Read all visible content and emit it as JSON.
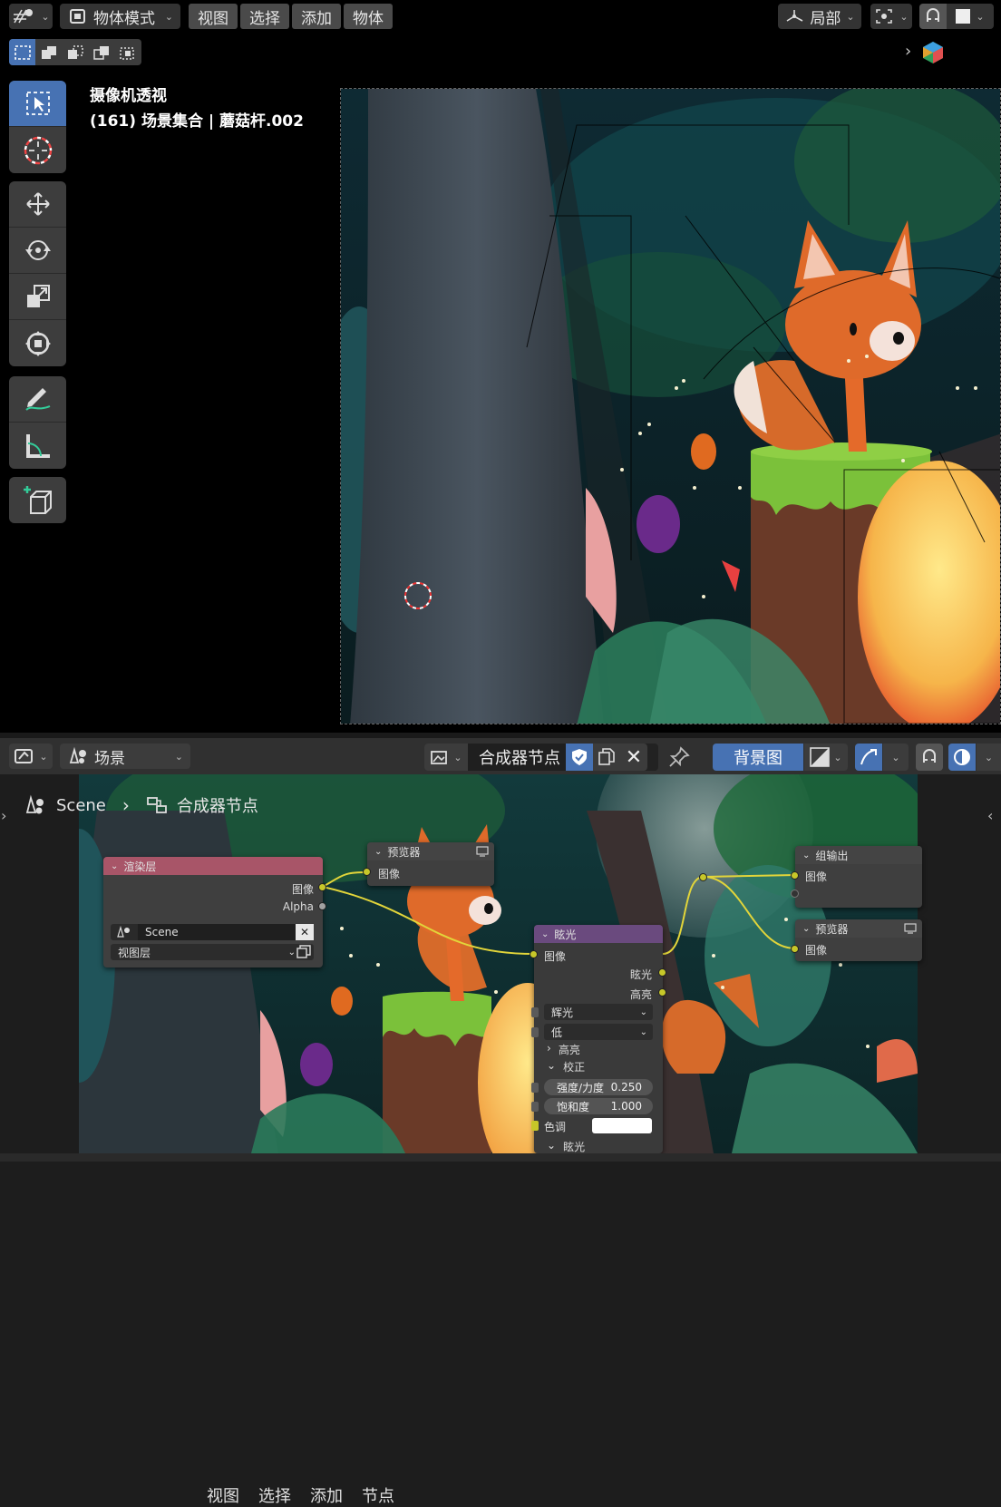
{
  "viewport_header": {
    "mode": "物体模式",
    "menus": [
      "视图",
      "选择",
      "添加",
      "物体"
    ],
    "transform_pivot": "局部"
  },
  "viewport": {
    "camera_label": "摄像机透视",
    "scene_info": "(161) 场景集合 | 蘑菇杆.002"
  },
  "node_header": {
    "editor_type": "场景",
    "menus": [
      "视图",
      "选择",
      "添加",
      "节点"
    ],
    "tree_name": "合成器节点",
    "backdrop_label": "背景图"
  },
  "breadcrumb": {
    "scene": "Scene",
    "tree": "合成器节点"
  },
  "nodes": {
    "render_layers": {
      "title": "渲染层",
      "out_image": "图像",
      "out_alpha": "Alpha",
      "scene": "Scene",
      "view_layer": "视图层"
    },
    "viewer_top": {
      "title": "预览器",
      "in_image": "图像"
    },
    "glare": {
      "title": "眩光",
      "in_image": "图像",
      "out_glare": "眩光",
      "out_highlight": "高亮",
      "type": "辉光",
      "quality": "低",
      "section_highlight": "高亮",
      "section_adjust": "校正",
      "strength_label": "强度/力度",
      "strength_value": "0.250",
      "saturation_label": "饱和度",
      "saturation_value": "1.000",
      "tint_label": "色调",
      "section_glare": "眩光"
    },
    "composite": {
      "title": "组输出",
      "in_image": "图像"
    },
    "viewer_right": {
      "title": "预览器",
      "in_image": "图像"
    }
  },
  "colors": {
    "accent_blue": "#4772b3",
    "render_layer_header": "#a85568",
    "glare_header": "#6a4a7e",
    "output_header": "#444444",
    "socket_yellow": "#c7c729"
  }
}
